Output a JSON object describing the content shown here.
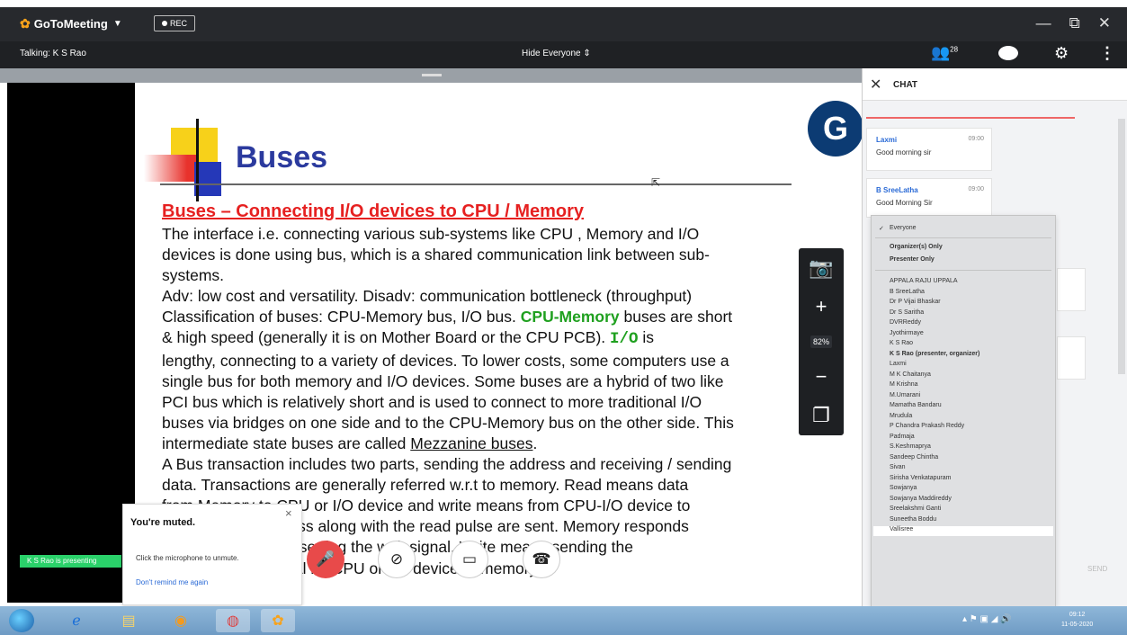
{
  "window": {
    "app_name": "GoToMeeting",
    "rec_label": "REC",
    "controls": [
      "—",
      "⧉",
      "✕"
    ]
  },
  "toolbar": {
    "talking": "Talking: K S Rao",
    "view_mode": "Hide Everyone",
    "participant_count": "28"
  },
  "slide": {
    "title": "Buses",
    "logo_letter": "G",
    "heading": "Buses – Connecting I/O devices to CPU / Memory",
    "body_lines": [
      "The interface i.e. connecting various sub-systems like CPU , Memory and I/O",
      "devices is done using bus, which is a shared communication link between sub-",
      "systems.",
      "Adv: low cost and versatility. Disadv: communication bottleneck (throughput)",
      "Classification of buses: CPU-Memory bus, I/O bus.",
      "CPU-Memory",
      "buses are short",
      "& high speed (generally it is on Mother Board or the CPU PCB).",
      "I/O",
      "is",
      "lengthy, connecting to a variety of devices. To lower costs, some computers use a",
      "single bus for both memory and I/O devices. Some buses are a hybrid of two like",
      "PCI bus which is relatively short and is used to connect to more traditional I/O",
      "buses via bridges on one side and to the CPU-Memory bus on the other side. This",
      "intermediate state buses are called",
      "Mezzanine buses",
      ".",
      "A Bus transaction includes two parts, sending the address and receiving / sending",
      "data. Transactions are generally referred w.r.t to memory. Read means data",
      "from Memory to CPU or I/O device and write means from CPU-I/O device to",
      "memory. The address along with the read pulse are sent. Memory responds",
      "with data after deasserting the wait signal. Write means sending the",
      "data and write signal by CPU or I/O device to memory."
    ]
  },
  "zoom": {
    "camera_icon": "camera-icon",
    "zoom_in": "+",
    "level": "82%",
    "zoom_out": "−",
    "fit_icon": "fit-screen-icon"
  },
  "muted_popup": {
    "title": "You're muted.",
    "text": "Click the microphone to unmute.",
    "link": "Don't remind me again",
    "close": "×"
  },
  "presenting_badge": "K S Rao is presenting",
  "chat": {
    "title": "CHAT",
    "messages": [
      {
        "name": "Laxmi",
        "time": "09:00",
        "text": "Good morning sir"
      },
      {
        "name": "B SreeLatha",
        "time": "09:00",
        "text": "Good Morning Sir"
      }
    ],
    "send_label": "SEND"
  },
  "recipients": {
    "selected": "Everyone",
    "groups": [
      "Organizer(s) Only",
      "Presenter Only"
    ],
    "people": [
      "APPALA RAJU UPPALA",
      "B SreeLatha",
      "Dr P Vijai Bhaskar",
      "Dr S Saritha",
      "DVRReddy",
      "Jyothirmaye",
      "K S Rao",
      "K S Rao (presenter, organizer)",
      "Laxmi",
      "M K Chaitanya",
      "M Krishna",
      "M.Umarani",
      "Mamatha Bandaru",
      "Mrudula",
      "P Chandra Prakash Reddy",
      "Padmaja",
      "S.Keshmaprya",
      "Sandeep Chintha",
      "Sivan",
      "Sirisha Venkatapuram",
      "Sowjanya",
      "Sowjanya Maddireddy",
      "Sreelakshmi Ganti",
      "Suneetha Boddu",
      "Vallisree"
    ]
  },
  "taskbar": {
    "clock_time": "09:12",
    "clock_date": "11-05-2020"
  },
  "colors": {
    "titlebar": "#27292d",
    "mic_muted": "#e84a4a",
    "slide_title": "#2b3a9e",
    "heading_red": "#e62020",
    "highlight_green": "#1fa01f",
    "brand_orange": "#f7a21b"
  }
}
